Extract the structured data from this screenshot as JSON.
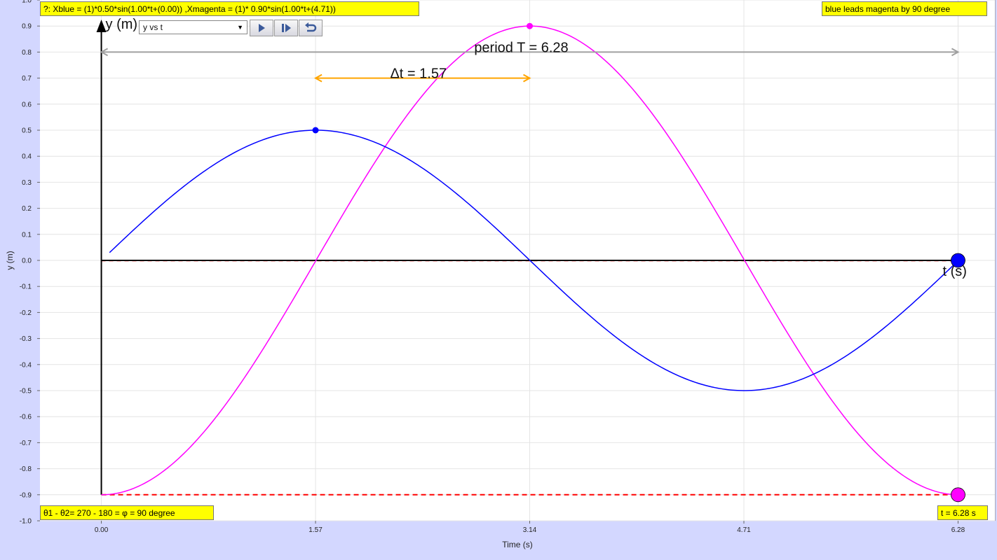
{
  "boxes": {
    "equation": "?: Xblue = (1)*0.50*sin(1.00*t+(0.00)) ,Xmagenta = (1)* 0.90*sin(1.00*t+(4.71))",
    "lead": "blue leads magenta by 90 degree",
    "phase": "θ1 - θ2= 270 - 180 = φ = 90 degree",
    "time": "t = 6.28 s"
  },
  "controls": {
    "select_value": "y vs t",
    "play_icon": "play-icon",
    "step_icon": "step-forward-icon",
    "reset_icon": "reset-icon"
  },
  "annotations": {
    "period": "period T = 6.28",
    "delta_t": "Δt = 1.57",
    "y_axis_arrow": "y (m)",
    "t_axis_arrow": "t (s)"
  },
  "colors": {
    "blue": "#0000ff",
    "magenta": "#ff00ff",
    "orange": "#ffa500",
    "gray": "#a0a0a0",
    "red": "#ff0000",
    "yellow": "#ffff00"
  },
  "chart_data": {
    "type": "line",
    "title": "",
    "xlabel": "Time (s)",
    "ylabel": "y (m)",
    "xlim": [
      -0.45,
      6.55
    ],
    "ylim": [
      -1.0,
      1.0
    ],
    "x_ticks": [
      0.0,
      1.57,
      3.14,
      4.71,
      6.28
    ],
    "x_tick_labels": [
      "0.00",
      "1.57",
      "3.14",
      "4.71",
      "6.28"
    ],
    "y_ticks": [
      1.0,
      0.9,
      0.8,
      0.7,
      0.6,
      0.5,
      0.4,
      0.3,
      0.2,
      0.1,
      0.0,
      -0.1,
      -0.2,
      -0.3,
      -0.4,
      -0.5,
      -0.6,
      -0.7,
      -0.8,
      -0.9,
      -1.0
    ],
    "y_tick_labels": [
      "1.0",
      "0.9",
      "0.8",
      "0.7",
      "0.6",
      "0.5",
      "0.4",
      "0.3",
      "0.2",
      "0.1",
      "0.0",
      "-0.1",
      "-0.2",
      "-0.3",
      "-0.4",
      "-0.5",
      "-0.6",
      "-0.7",
      "-0.8",
      "-0.9",
      "-1.0"
    ],
    "grid": true,
    "series": [
      {
        "amplitude": 0.5,
        "omega": 1.0,
        "phase": 0.0,
        "t_start": 0.06,
        "t_end": 6.28,
        "color": "#0000ff"
      },
      {
        "amplitude": 0.9,
        "omega": 1.0,
        "phase": 4.71,
        "t_start": 0.0,
        "t_end": 6.28,
        "color": "#ff00ff"
      }
    ],
    "markers": [
      {
        "x": 1.57,
        "y": 0.5,
        "color": "#0000ff",
        "size": "small"
      },
      {
        "x": 3.14,
        "y": 0.9,
        "color": "#ff00ff",
        "size": "small"
      },
      {
        "x": 6.28,
        "y": 0.0,
        "color": "#0000ff",
        "size": "large"
      },
      {
        "x": 6.28,
        "y": -0.9,
        "color": "#ff00ff",
        "size": "large"
      }
    ],
    "period_span": [
      0.0,
      6.28
    ],
    "period_y": 0.8,
    "delta_span": [
      1.57,
      3.14
    ],
    "delta_y": 0.7,
    "reference_line_y": -0.9
  }
}
